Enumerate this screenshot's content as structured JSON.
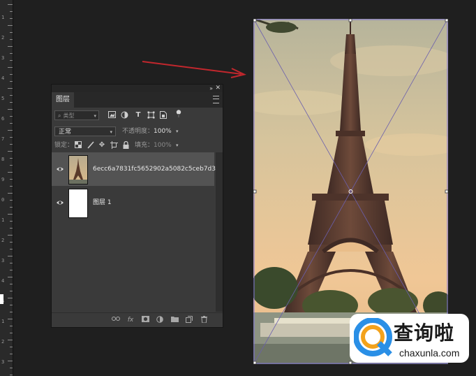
{
  "ruler": {
    "numbers": [
      "1",
      "2",
      "3",
      "4",
      "5",
      "6",
      "7",
      "8",
      "9",
      "0",
      "1",
      "2",
      "3",
      "4",
      "5",
      "1",
      "2",
      "3"
    ]
  },
  "layers_panel": {
    "collapse_glyph": "»",
    "close_glyph": "✕",
    "tab_label": "图层",
    "filter": {
      "label": "类型",
      "icons": [
        "image-filter-icon",
        "adjustment-filter-icon",
        "type-filter-icon",
        "shape-filter-icon",
        "smart-object-filter-icon",
        "filter-toggle-icon"
      ]
    },
    "blend_mode": "正常",
    "opacity_label": "不透明度：",
    "opacity_value": "100%",
    "lock_label": "锁定：",
    "fill_label": "填充：",
    "fill_value": "100%",
    "layers": [
      {
        "name": "6ecc6a7831fc5652902a5082c5ceb7d3",
        "selected": true,
        "visible": true
      },
      {
        "name": "图层 1",
        "selected": false,
        "visible": true
      }
    ],
    "footer_icons": [
      "link-layers-icon",
      "fx-icon",
      "mask-icon",
      "adjustment-layer-icon",
      "group-folder-icon",
      "new-layer-icon",
      "trash-icon"
    ]
  },
  "watermark": {
    "title": "查询啦",
    "url": "chaxunla.com"
  },
  "colors": {
    "workspace": "#1f1f1f",
    "panel": "#3a3a3a",
    "selected_layer": "#535353",
    "arrow": "#c2272d",
    "transform_box": "#7c6fd6",
    "watermark_accent": "#2a8fe6",
    "watermark_orange": "#f3a21b"
  }
}
